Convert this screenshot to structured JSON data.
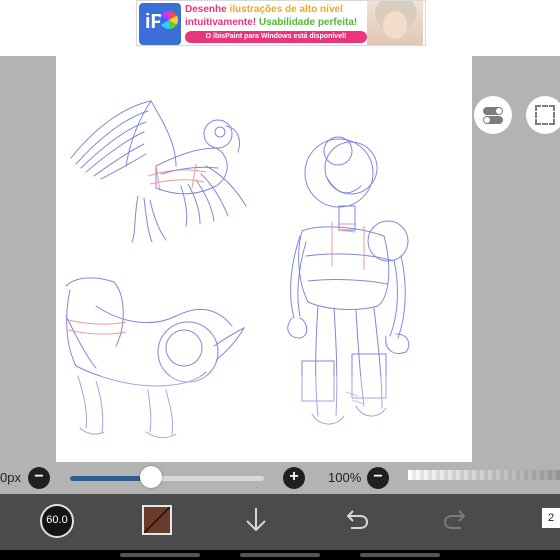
{
  "ad": {
    "line1_pre": "Desenhe ",
    "line1_hl": "ilustrações de alto nível",
    "line2_pre": "intuitivamente! ",
    "line2_hl": "Usabilidade perfeita!",
    "cta": "O ibisPaint para Windows está disponível!",
    "logo_text": "iP"
  },
  "brush": {
    "size_label": "0px",
    "size_fraction": 0.42,
    "size_minus": "−",
    "size_plus": "+",
    "indicator_value": "60.0"
  },
  "opacity": {
    "label": "100%",
    "minus": "−",
    "value_percent": 100
  },
  "toolbar": {
    "icons": [
      "brush-size-icon",
      "color-swatch-icon",
      "download-arrow-icon",
      "undo-icon",
      "redo-icon",
      "page-count-icon"
    ],
    "page_count": "2",
    "current_color": "#6a3a2a"
  },
  "side": {
    "icons": [
      "layer-toggle-icon",
      "selection-icon"
    ]
  },
  "colors": {
    "sketch_blue": "#6b73d6",
    "sketch_red": "#e88a8a",
    "slider_fill": "#2f5e8e",
    "toolbar_bg": "#4b4b4b"
  }
}
